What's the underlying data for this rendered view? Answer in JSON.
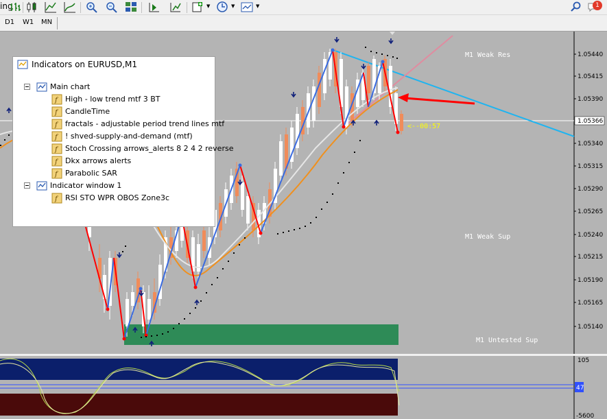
{
  "toolbar": {
    "cut_text": "ing",
    "buttons": [
      "bar-chart-icon",
      "candles-icon",
      "line-chart-icon",
      "zoom-in-icon",
      "zoom-out-icon",
      "tile-windows-icon",
      "scroll-end-icon",
      "chart-shift-icon",
      "add-indicator-icon",
      "periods-icon",
      "templates-icon"
    ],
    "right_icons": [
      "search-icon",
      "notifications-icon"
    ],
    "notification_count": "1"
  },
  "timeframes": [
    "D1",
    "W1",
    "MN"
  ],
  "indicators_panel": {
    "title": "Indicators on EURUSD,M1",
    "groups": [
      {
        "name": "Main chart",
        "items": [
          "High - low trend mtf 3 BT",
          "CandleTime",
          "fractals - adjustable period trend lines mtf",
          "! shved-supply-and-demand (mtf)",
          "Stoch Crossing arrows_alerts 8 2 4 2 reverse",
          "Dkx arrows alerts",
          "Parabolic SAR"
        ]
      },
      {
        "name": "Indicator window 1",
        "items": [
          "RSI STO WPR OBOS Zone3c"
        ]
      }
    ]
  },
  "chart": {
    "zone_labels": {
      "weak_res": "M1 Weak Res",
      "weak_sup": "M1 Weak Sup",
      "untested_sup": "M1 Untested Sup"
    },
    "candle_time": "<--00:57",
    "current_price": "1.05366",
    "price_axis": [
      "1.05440",
      "1.05415",
      "1.05390",
      "1.05340",
      "1.05315",
      "1.05290",
      "1.05265",
      "1.05240",
      "1.05215",
      "1.05190",
      "1.05165",
      "1.05140"
    ],
    "sub_axis": {
      "top": "105",
      "level": "47",
      "bottom": "-5",
      "bottom_extra": "600"
    },
    "colors": {
      "background": "#b4b4b4",
      "bull": "#ffffff",
      "bear": "#f08c5a",
      "zigzag_up": "#3a6be0",
      "zigzag_down": "#ff0000",
      "trendline": "#1fb4f0",
      "ma_orange": "#f0901e",
      "ma_white": "#e6e6e6",
      "supply_zone": "#2e8b57",
      "obos_top": "#0b1f6b",
      "obos_bottom": "#4a0a0a"
    }
  }
}
